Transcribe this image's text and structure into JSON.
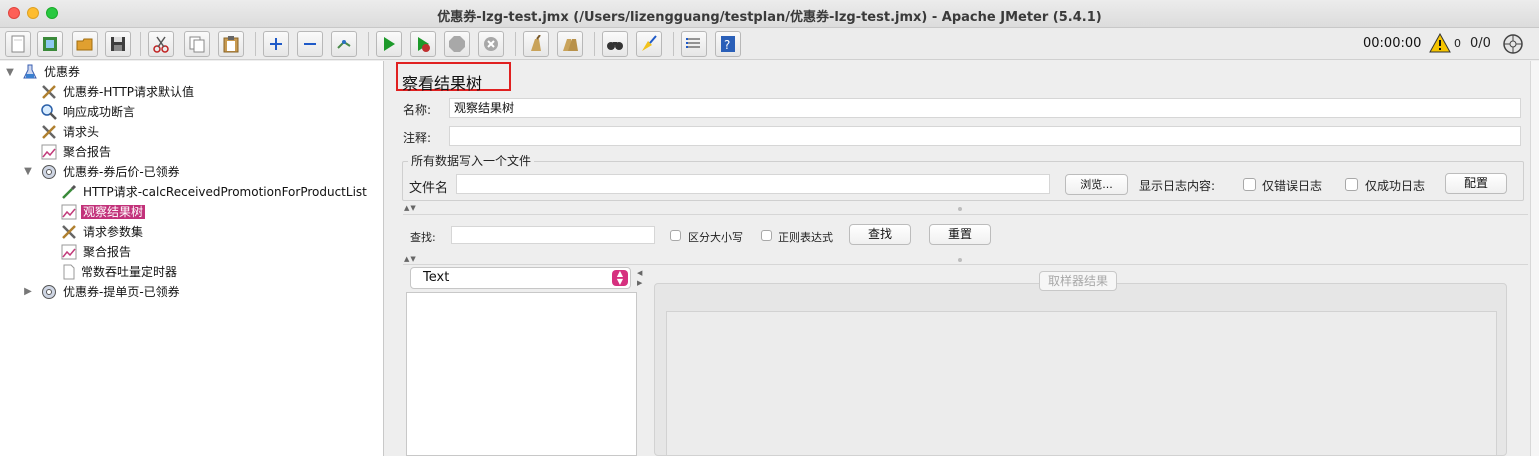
{
  "window": {
    "title": "优惠券-lzg-test.jmx (/Users/lizengguang/testplan/优惠券-lzg-test.jmx) - Apache JMeter (5.4.1)"
  },
  "toolbar": {
    "buttons": [
      "new-icon",
      "templates-icon",
      "open-icon",
      "save-icon",
      "cut-icon",
      "copy-icon",
      "paste-icon",
      "expand-icon",
      "collapse-icon",
      "toggle-icon",
      "start-icon",
      "start-no-pause-icon",
      "stop-icon",
      "shutdown-icon",
      "clear-icon",
      "clear-all-icon",
      "search-icon",
      "reset-search-icon",
      "function-helper-icon",
      "help-icon"
    ],
    "timer": "00:00:00",
    "warning_count": "0",
    "threads": "0/0"
  },
  "tree": {
    "items": [
      {
        "label": "优惠券",
        "icon": "test-plan-icon"
      },
      {
        "label": "优惠券-HTTP请求默认值",
        "icon": "config-wrench-icon"
      },
      {
        "label": "响应成功断言",
        "icon": "assertion-magnifier-icon"
      },
      {
        "label": "请求头",
        "icon": "config-wrench-icon"
      },
      {
        "label": "聚合报告",
        "icon": "listener-chart-icon"
      },
      {
        "label": "优惠券-券后价-已领券",
        "icon": "thread-group-gear-icon"
      },
      {
        "label": "HTTP请求-calcReceivedPromotionForProductList",
        "icon": "sampler-pipette-icon"
      },
      {
        "label": "观察结果树",
        "icon": "listener-chart-icon"
      },
      {
        "label": "请求参数集",
        "icon": "config-wrench-icon"
      },
      {
        "label": "聚合报告",
        "icon": "listener-chart-icon"
      },
      {
        "label": "常数吞吐量定时器",
        "icon": "timer-doc-icon"
      },
      {
        "label": "优惠券-提单页-已领券",
        "icon": "thread-group-gear-icon"
      }
    ]
  },
  "panel": {
    "heading": "察看结果树",
    "name_label": "名称:",
    "name_value": "观察结果树",
    "comment_label": "注释:",
    "comment_value": "",
    "file_group_title": "所有数据写入一个文件",
    "filename_label": "文件名",
    "filename_value": "",
    "browse_label": "浏览...",
    "log_content_label": "显示日志内容:",
    "errors_only_label": "仅错误日志",
    "success_only_label": "仅成功日志",
    "configure_label": "配置",
    "search_label": "查找:",
    "search_value": "",
    "case_sensitive_label": "区分大小写",
    "regex_label": "正则表达式",
    "find_button": "查找",
    "reset_button": "重置",
    "renderer_value": "Text",
    "sampler_result_tab": "取样器结果"
  },
  "colors": {
    "selection": "#c2327a",
    "highlight_border": "#e02020",
    "select_accent": "#d6307f"
  }
}
